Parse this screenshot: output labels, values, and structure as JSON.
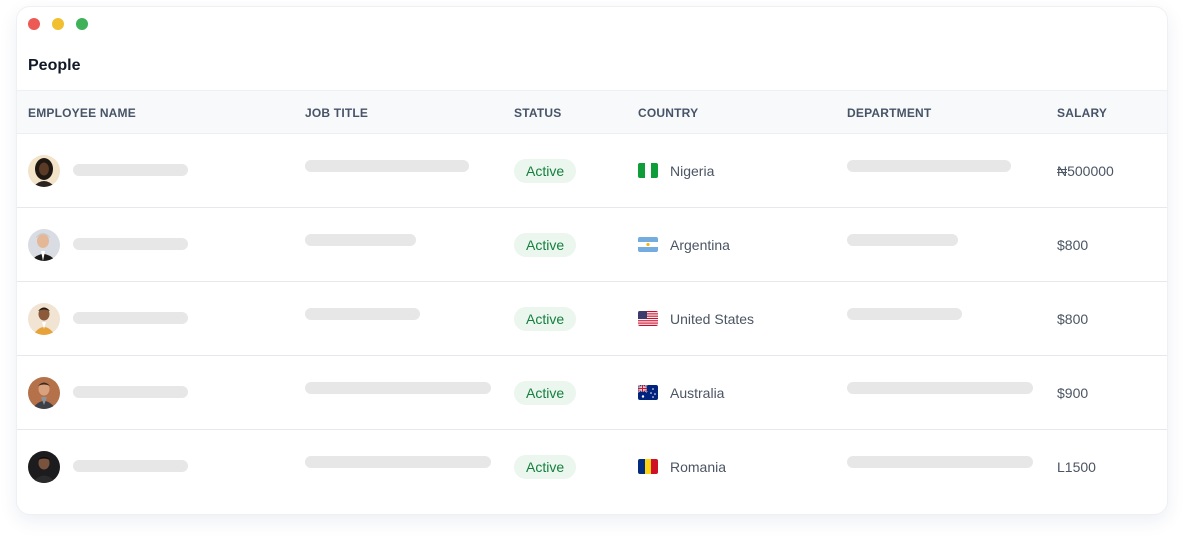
{
  "window": {
    "controls": [
      "close",
      "minimize",
      "maximize"
    ]
  },
  "page": {
    "title": "People"
  },
  "table": {
    "columns": [
      "EMPLOYEE NAME",
      "JOB TITLE",
      "STATUS",
      "COUNTRY",
      "DEPARTMENT",
      "SALARY"
    ],
    "rows": [
      {
        "status": "Active",
        "country": "Nigeria",
        "flag": "nigeria-flag-icon",
        "salary": "₦500000"
      },
      {
        "status": "Active",
        "country": "Argentina",
        "flag": "argentina-flag-icon",
        "salary": "$800"
      },
      {
        "status": "Active",
        "country": "United States",
        "flag": "united-states-flag-icon",
        "salary": "$800"
      },
      {
        "status": "Active",
        "country": "Australia",
        "flag": "australia-flag-icon",
        "salary": "$900"
      },
      {
        "status": "Active",
        "country": "Romania",
        "flag": "romania-flag-icon",
        "salary": "L1500"
      }
    ]
  },
  "colors": {
    "status_active_bg": "#eaf6ee",
    "status_active_text": "#15803d",
    "header_bg": "#f8f9fb",
    "skeleton": "#e7e7e7"
  }
}
